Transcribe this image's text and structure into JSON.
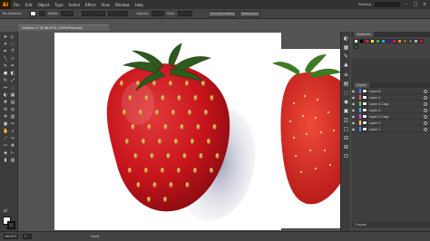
{
  "app": {
    "logo": "Ai"
  },
  "menu": [
    "File",
    "Edit",
    "Object",
    "Type",
    "Select",
    "Effect",
    "View",
    "Window",
    "Help"
  ],
  "menu_right": {
    "workspace": "Painting",
    "search_placeholder": ""
  },
  "control_bar": {
    "selection_label": "No Selection",
    "stroke_label": "Stroke:",
    "opacity_label": "Opacity:",
    "style_label": "Style:",
    "doc_setup_button": "Document Setup",
    "preferences_button": "Preferences"
  },
  "document": {
    "tab_title": "Untitled-1* @ 66.67% (CMYK/Preview)"
  },
  "panels": {
    "swatches_tab": "Swatches",
    "layers_tab": "Layers",
    "layers_count": "7 Layers",
    "layers": [
      {
        "name": "Layer 6",
        "color": "#4f7cff"
      },
      {
        "name": "Layer 5",
        "color": "#ff4f4f"
      },
      {
        "name": "Layer 4 Copy",
        "color": "#4fd14f"
      },
      {
        "name": "Layer 4",
        "color": "#4f9bff"
      },
      {
        "name": "Layer 3 Copy",
        "color": "#d14fd1"
      },
      {
        "name": "Layer 3",
        "color": "#ffd14f"
      },
      {
        "name": "Layer 1",
        "color": "#4f7cff"
      }
    ]
  },
  "status": {
    "zoom": "66.67%",
    "page": "1",
    "tool": "Hand"
  },
  "colors": {
    "strawberry_red": "#c8141c",
    "leaf_green": "#2f5a1e",
    "seed_gold": "#d9a63a"
  },
  "icons": [
    "selection-icon",
    "direct-selection-icon",
    "pen-icon",
    "type-icon",
    "line-icon",
    "rectangle-icon",
    "brush-icon",
    "pencil-icon",
    "rotate-icon",
    "scale-icon",
    "gradient-icon",
    "eyedropper-icon",
    "hand-icon",
    "zoom-icon"
  ]
}
